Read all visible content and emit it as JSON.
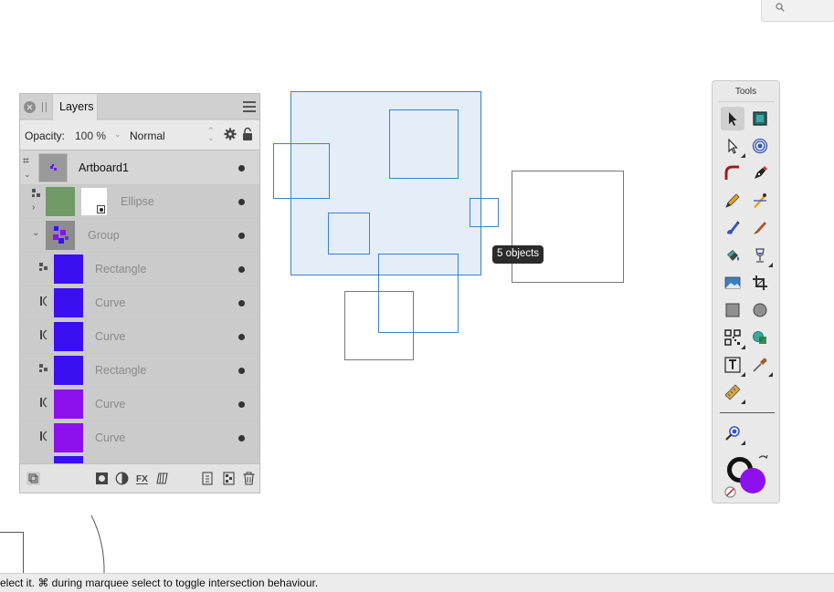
{
  "search": {
    "icon": "search-icon"
  },
  "layers_panel": {
    "tab_label": "Layers",
    "opacity_label": "Opacity:",
    "opacity_value": "100 %",
    "blend_mode": "Normal",
    "rows": [
      {
        "name": "Artboard1",
        "kind": "artboard"
      },
      {
        "name": "Ellipse",
        "kind": "ellipse"
      },
      {
        "name": "Group",
        "kind": "group"
      },
      {
        "name": "Rectangle",
        "kind": "rectangle",
        "color": "#3a10f0"
      },
      {
        "name": "Curve",
        "kind": "curve",
        "color": "#3a10f0"
      },
      {
        "name": "Curve",
        "kind": "curve",
        "color": "#3a10f0"
      },
      {
        "name": "Rectangle",
        "kind": "rectangle",
        "color": "#3a10f0"
      },
      {
        "name": "Curve",
        "kind": "curve",
        "color": "#8d10ef"
      },
      {
        "name": "Curve",
        "kind": "curve",
        "color": "#8d10ef"
      }
    ]
  },
  "canvas": {
    "tooltip": "5 objects",
    "selection_color": "#3f80c7"
  },
  "tools_panel": {
    "title": "Tools",
    "fill_color": "#8d10ef",
    "stroke_color": "#111111"
  },
  "status_bar": {
    "text": "elect it. ⌘ during marquee select to toggle intersection behaviour."
  }
}
